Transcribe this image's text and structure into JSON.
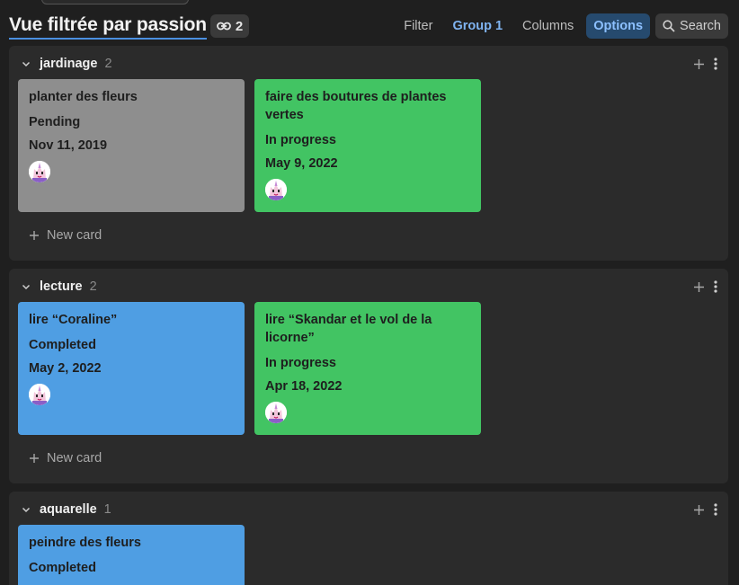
{
  "header": {
    "title": "Vue filtrée par passion",
    "link_count": "2"
  },
  "toolbar": {
    "filter": "Filter",
    "group": "Group 1",
    "columns": "Columns",
    "options": "Options",
    "search": "Search"
  },
  "groups": [
    {
      "name": "jardinage",
      "count": "2",
      "new_card": "New card",
      "cards": [
        {
          "title": "planter des fleurs",
          "status": "Pending",
          "date": "Nov 11, 2019",
          "color": "#8e8e8e"
        },
        {
          "title": "faire des boutures de plantes vertes",
          "status": "In progress",
          "date": "May 9, 2022",
          "color": "#42c463"
        }
      ]
    },
    {
      "name": "lecture",
      "count": "2",
      "new_card": "New card",
      "cards": [
        {
          "title": "lire “Coraline”",
          "status": "Completed",
          "date": "May 2, 2022",
          "color": "#4f9ee3"
        },
        {
          "title": "lire “Skandar et le vol de la licorne”",
          "status": "In progress",
          "date": "Apr 18, 2022",
          "color": "#42c463"
        }
      ]
    },
    {
      "name": "aquarelle",
      "count": "1",
      "cards": [
        {
          "title": "peindre des fleurs",
          "status": "Completed",
          "color": "#4f9ee3"
        }
      ]
    }
  ]
}
